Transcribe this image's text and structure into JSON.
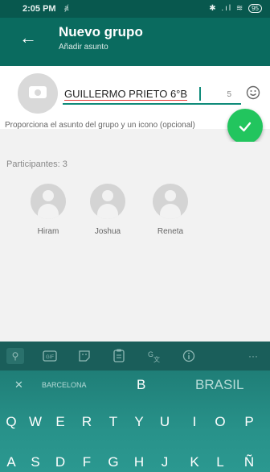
{
  "status": {
    "time": "2:05 PM",
    "sim_icon": "ⱥ",
    "signal_text": "✱ .ıl ≋",
    "battery": "95"
  },
  "header": {
    "title": "Nuevo grupo",
    "subtitle": "Añadir asunto"
  },
  "subject": {
    "value": "GUILLERMO PRIETO 6°B",
    "char_count": "5",
    "hint": "Proporciona el asunto del grupo y un icono (opcional)"
  },
  "participants": {
    "label": "Participantes: 3",
    "members": [
      "Hiram",
      "Joshua",
      "Reneta"
    ]
  },
  "keyboard": {
    "toolbar_icons": [
      "search-icon",
      "gif-icon",
      "sticker-icon",
      "clipboard-icon",
      "translate-icon",
      "info-icon",
      "more-icon"
    ],
    "suggestions": {
      "dismiss": "✕",
      "left": "BARCELONA",
      "middle": "B",
      "right": "BRASIL"
    },
    "row1": [
      "Q",
      "W",
      "E",
      "R",
      "T",
      "Y",
      "U",
      "I",
      "O",
      "P"
    ],
    "row2": [
      "A",
      "S",
      "D",
      "F",
      "G",
      "H",
      "J",
      "K",
      "L",
      "Ñ"
    ]
  },
  "colors": {
    "header": "#0a6b5f",
    "accent": "#0f8b7a",
    "fab": "#22c55e",
    "keyboard": "#1f7e77"
  }
}
